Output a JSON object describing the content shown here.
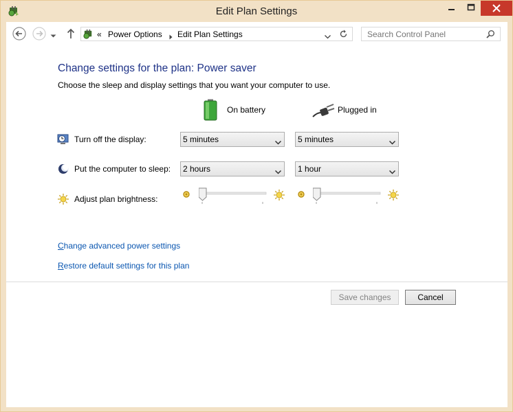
{
  "window": {
    "title": "Edit Plan Settings"
  },
  "navbar": {
    "breadcrumb_chevrons": "«",
    "breadcrumb": [
      "Power Options",
      "Edit Plan Settings"
    ],
    "search_placeholder": "Search Control Panel"
  },
  "main": {
    "heading": "Change settings for the plan: Power saver",
    "subtext": "Choose the sleep and display settings that you want your computer to use.",
    "columns": {
      "battery": "On battery",
      "plugged": "Plugged in"
    },
    "rows": {
      "display": {
        "label": "Turn off the display:",
        "battery": "5 minutes",
        "plugged": "5 minutes"
      },
      "sleep": {
        "label": "Put the computer to sleep:",
        "battery": "2 hours",
        "plugged": "1 hour"
      },
      "brightness": {
        "label": "Adjust plan brightness:",
        "battery_level": 0.0,
        "plugged_level": 0.0
      }
    },
    "links": {
      "advanced": {
        "accel": "C",
        "rest": "hange advanced power settings"
      },
      "restore": {
        "accel": "R",
        "rest": "estore default settings for this plan"
      }
    }
  },
  "footer": {
    "save_label": "Save changes",
    "cancel_label": "Cancel"
  },
  "colors": {
    "heading": "#1e3287",
    "link": "#0a56b0",
    "frame": "#f2e1c6",
    "close_button": "#c7382a"
  }
}
